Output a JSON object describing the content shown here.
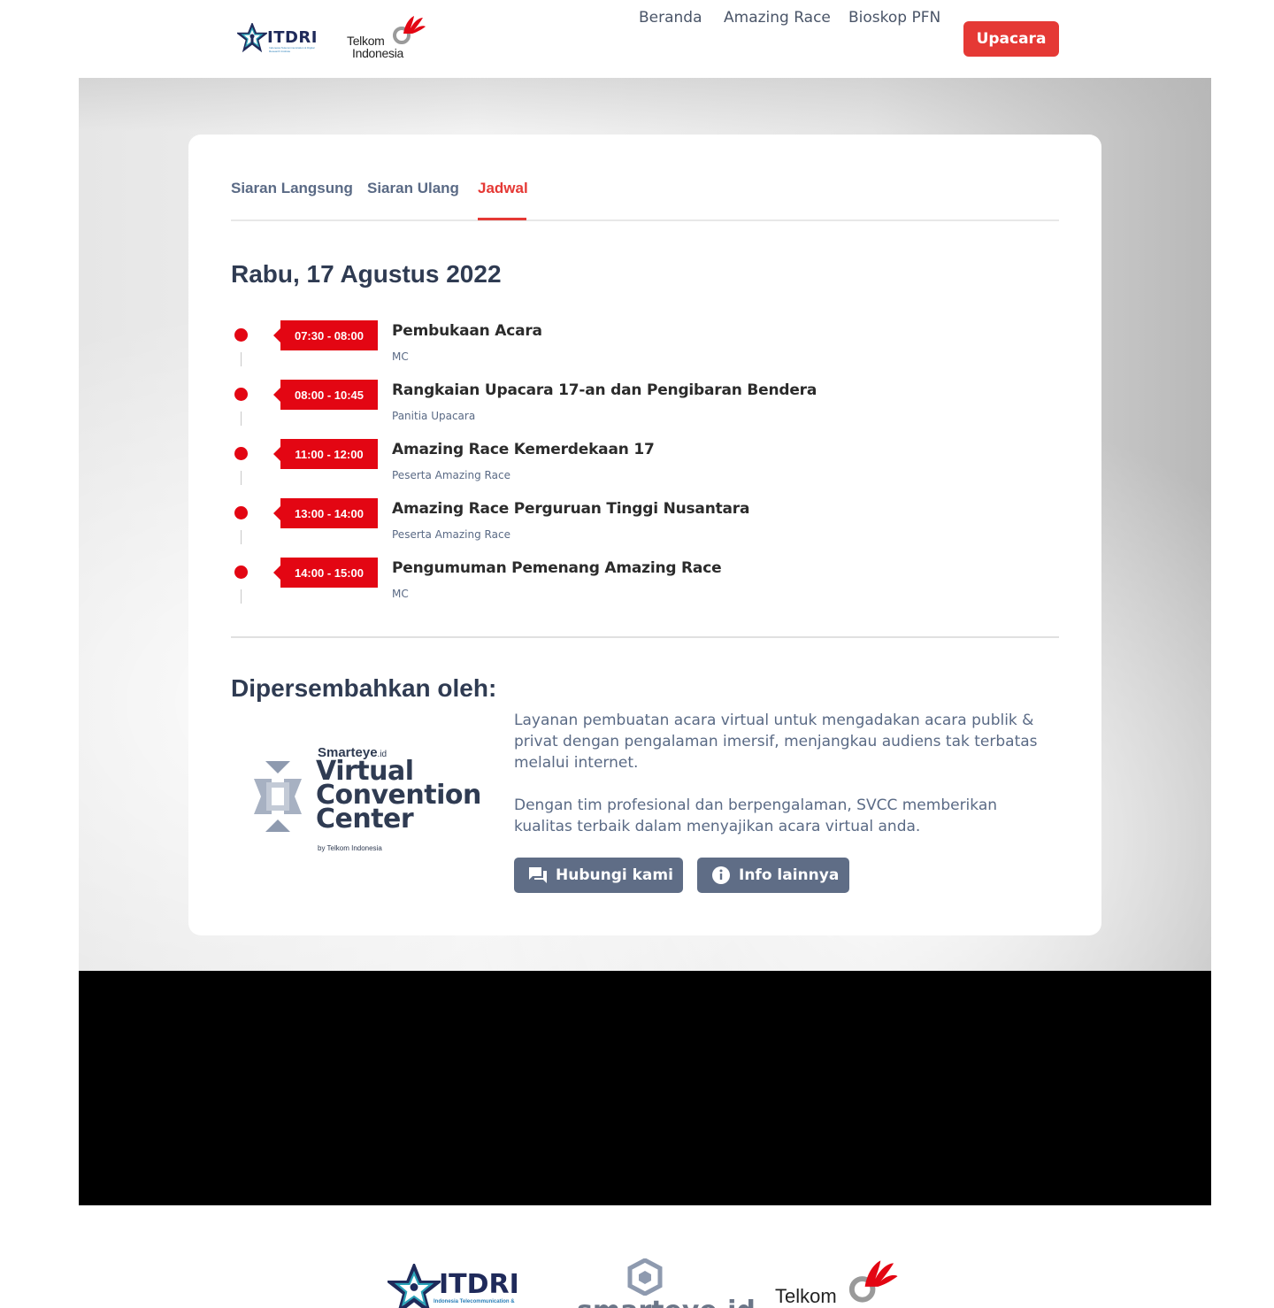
{
  "header": {
    "logos": {
      "itdri": {
        "text": "ITDRI",
        "subtext": "Indonesia Telecommunication & Digital Research Institute"
      },
      "telkom": {
        "line1": "Telkom",
        "line2": "Indonesia"
      }
    },
    "nav": [
      {
        "label": "Beranda"
      },
      {
        "label": "Amazing Race"
      },
      {
        "label": "Bioskop PFN"
      }
    ],
    "cta_label": "Upacara"
  },
  "tabs": [
    {
      "label": "Siaran Langsung",
      "active": false
    },
    {
      "label": "Siaran Ulang",
      "active": false
    },
    {
      "label": "Jadwal",
      "active": true
    }
  ],
  "schedule": {
    "date": "Rabu, 17 Agustus 2022",
    "items": [
      {
        "time": "07:30 - 08:00",
        "title": "Pembukaan Acara",
        "host": "MC"
      },
      {
        "time": "08:00 - 10:45",
        "title": "Rangkaian Upacara 17-an dan Pengibaran Bendera",
        "host": "Panitia Upacara"
      },
      {
        "time": "11:00 - 12:00",
        "title": "Amazing Race Kemerdekaan 17",
        "host": "Peserta Amazing Race"
      },
      {
        "time": "13:00 - 14:00",
        "title": "Amazing Race Perguruan Tinggi Nusantara",
        "host": "Peserta Amazing Race"
      },
      {
        "time": "14:00 - 15:00",
        "title": "Pengumuman Pemenang Amazing Race",
        "host": "MC"
      }
    ]
  },
  "presented": {
    "title": "Dipersembahkan oleh:",
    "logo": {
      "brand": "Smarteye",
      "brand_suffix": ".id",
      "line1": "Virtual",
      "line2": "Convention",
      "line3": "Center",
      "by": "by Telkom Indonesia"
    },
    "paragraph1": "Layanan pembuatan acara virtual untuk mengadakan acara publik & privat dengan pengalaman imersif, menjangkau audiens tak terbatas melalui internet.",
    "paragraph2": "Dengan tim profesional dan berpengalaman, SVCC memberikan kualitas terbaik dalam menyajikan acara virtual anda.",
    "buttons": [
      {
        "label": "Hubungi kami",
        "icon": "chat-icon"
      },
      {
        "label": "Info lainnya",
        "icon": "info-icon"
      }
    ]
  },
  "footer": {
    "logos": {
      "itdri": {
        "text": "ITDRI",
        "subtext": "Indonesia Telecommunication &"
      },
      "smarteye": {
        "text": "smarteye.id"
      },
      "telkom": {
        "text": "Telkom"
      }
    }
  },
  "colors": {
    "accent": "#e53935",
    "badge_red": "#e30613",
    "button_slate": "#5f6d86",
    "heading": "#2f3b52"
  }
}
